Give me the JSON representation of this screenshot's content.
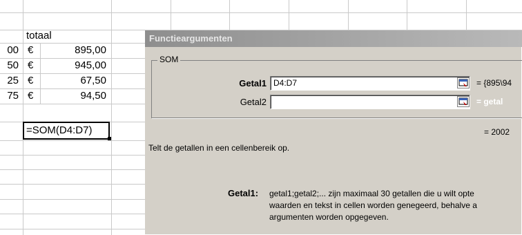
{
  "sheet": {
    "header_label": "totaal",
    "rows": [
      {
        "prefix": "00",
        "currency": "€",
        "value": "895,00"
      },
      {
        "prefix": "50",
        "currency": "€",
        "value": "945,00"
      },
      {
        "prefix": "25",
        "currency": "€",
        "value": "67,50"
      },
      {
        "prefix": "75",
        "currency": "€",
        "value": "94,50"
      }
    ],
    "active_cell_formula": "=SOM(D4:D7)"
  },
  "dialog": {
    "title": "Functieargumenten",
    "group_label": "SOM",
    "args": [
      {
        "label": "Getal1",
        "value": "D4:D7",
        "result": "= {895\\94"
      },
      {
        "label": "Getal2",
        "value": "",
        "result": "= getal"
      }
    ],
    "total_result": "= 2002",
    "description": "Telt de getallen in een cellenbereik op.",
    "help_label": "Getal1:",
    "help_lines": [
      "getal1;getal2;... zijn maximaal 30 getallen die u wilt opte",
      "waarden en tekst in cellen worden genegeerd, behalve a",
      "argumenten worden opgegeven."
    ]
  },
  "colors": {
    "dialog_bg": "#d4d0c8",
    "titlebar_inactive": "#a0a0a0",
    "gridline": "#c9c9c9"
  }
}
